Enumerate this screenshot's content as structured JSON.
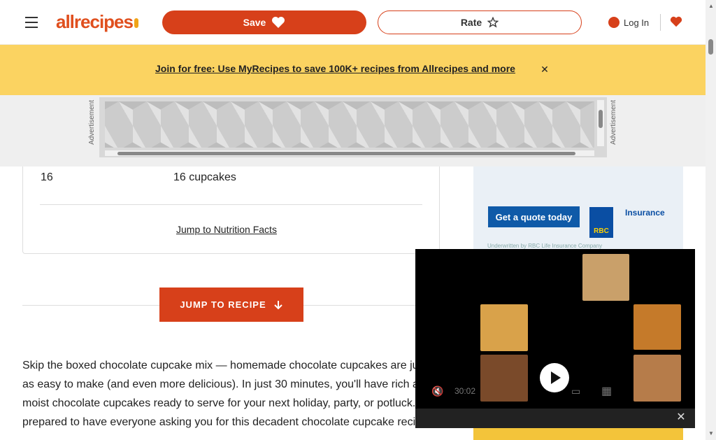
{
  "header": {
    "logo_text": "allrecipes",
    "save_label": "Save",
    "rate_label": "Rate",
    "login_label": "Log In"
  },
  "banner": {
    "text": "Join for free: Use MyRecipes to save 100K+ recipes from Allrecipes and more",
    "close_glyph": "✕"
  },
  "ad_strip": {
    "label": "Advertisement"
  },
  "servings": {
    "number": "16",
    "yield": "16 cupcakes"
  },
  "jump_nutrition_label": "Jump to Nutrition Facts",
  "jump_recipe_label": "JUMP TO RECIPE",
  "description": "Skip the boxed chocolate cupcake mix — homemade chocolate cupcakes are just as easy to make (and even more delicious). In just 30 minutes, you'll have rich and moist chocolate cupcakes ready to serve for your next holiday, party, or potluck. Be prepared to have everyone asking you for this decadent chocolate cupcake recipe!",
  "side_ad": {
    "cta": "Get a quote today",
    "brand": "RBC",
    "product": "Insurance",
    "small_text": "Underwritten by RBC Life Insurance Company"
  },
  "video": {
    "time": "30:02",
    "close_glyph": "✕"
  },
  "colors": {
    "brand": "#d7401a",
    "banner": "#fbd361"
  }
}
